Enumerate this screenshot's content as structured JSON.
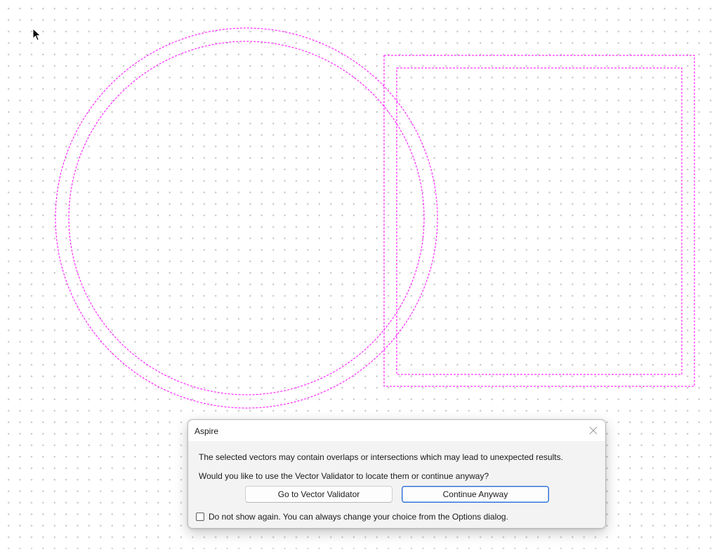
{
  "canvas": {
    "vector_color": "#ff00ff",
    "grid_dot_color": "#c4c4c4",
    "vectors": [
      {
        "type": "circle",
        "name": "outer-circle"
      },
      {
        "type": "circle",
        "name": "inner-circle"
      },
      {
        "type": "rectangle",
        "name": "outer-rectangle"
      },
      {
        "type": "rectangle",
        "name": "inner-rectangle"
      }
    ]
  },
  "cursor": {
    "icon": "arrow-cursor-icon"
  },
  "dialog": {
    "title": "Aspire",
    "close_icon": "close-icon",
    "message_line1": "The selected vectors may contain overlaps or intersections which may lead to unexpected results.",
    "message_line2": "Would you like to use the Vector Validator to locate them or continue anyway?",
    "validator_button": "Go to Vector Validator",
    "continue_button": "Continue Anyway",
    "checkbox_label": "Do not show again. You can always change your choice from the Options dialog.",
    "checkbox_checked": false,
    "accent_color": "#2f6fd6"
  }
}
